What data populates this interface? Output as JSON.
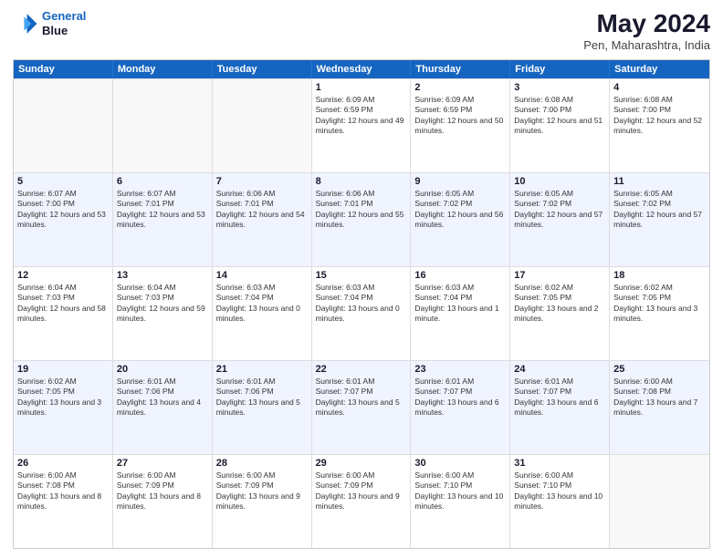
{
  "header": {
    "logo_line1": "General",
    "logo_line2": "Blue",
    "month": "May 2024",
    "location": "Pen, Maharashtra, India"
  },
  "weekdays": [
    "Sunday",
    "Monday",
    "Tuesday",
    "Wednesday",
    "Thursday",
    "Friday",
    "Saturday"
  ],
  "rows": [
    {
      "alt": false,
      "cells": [
        {
          "day": "",
          "empty": true
        },
        {
          "day": "",
          "empty": true
        },
        {
          "day": "",
          "empty": true
        },
        {
          "day": "1",
          "sunrise": "6:09 AM",
          "sunset": "6:59 PM",
          "daylight": "12 hours and 49 minutes."
        },
        {
          "day": "2",
          "sunrise": "6:09 AM",
          "sunset": "6:59 PM",
          "daylight": "12 hours and 50 minutes."
        },
        {
          "day": "3",
          "sunrise": "6:08 AM",
          "sunset": "7:00 PM",
          "daylight": "12 hours and 51 minutes."
        },
        {
          "day": "4",
          "sunrise": "6:08 AM",
          "sunset": "7:00 PM",
          "daylight": "12 hours and 52 minutes."
        }
      ]
    },
    {
      "alt": true,
      "cells": [
        {
          "day": "5",
          "sunrise": "6:07 AM",
          "sunset": "7:00 PM",
          "daylight": "12 hours and 53 minutes."
        },
        {
          "day": "6",
          "sunrise": "6:07 AM",
          "sunset": "7:01 PM",
          "daylight": "12 hours and 53 minutes."
        },
        {
          "day": "7",
          "sunrise": "6:06 AM",
          "sunset": "7:01 PM",
          "daylight": "12 hours and 54 minutes."
        },
        {
          "day": "8",
          "sunrise": "6:06 AM",
          "sunset": "7:01 PM",
          "daylight": "12 hours and 55 minutes."
        },
        {
          "day": "9",
          "sunrise": "6:05 AM",
          "sunset": "7:02 PM",
          "daylight": "12 hours and 56 minutes."
        },
        {
          "day": "10",
          "sunrise": "6:05 AM",
          "sunset": "7:02 PM",
          "daylight": "12 hours and 57 minutes."
        },
        {
          "day": "11",
          "sunrise": "6:05 AM",
          "sunset": "7:02 PM",
          "daylight": "12 hours and 57 minutes."
        }
      ]
    },
    {
      "alt": false,
      "cells": [
        {
          "day": "12",
          "sunrise": "6:04 AM",
          "sunset": "7:03 PM",
          "daylight": "12 hours and 58 minutes."
        },
        {
          "day": "13",
          "sunrise": "6:04 AM",
          "sunset": "7:03 PM",
          "daylight": "12 hours and 59 minutes."
        },
        {
          "day": "14",
          "sunrise": "6:03 AM",
          "sunset": "7:04 PM",
          "daylight": "13 hours and 0 minutes."
        },
        {
          "day": "15",
          "sunrise": "6:03 AM",
          "sunset": "7:04 PM",
          "daylight": "13 hours and 0 minutes."
        },
        {
          "day": "16",
          "sunrise": "6:03 AM",
          "sunset": "7:04 PM",
          "daylight": "13 hours and 1 minute."
        },
        {
          "day": "17",
          "sunrise": "6:02 AM",
          "sunset": "7:05 PM",
          "daylight": "13 hours and 2 minutes."
        },
        {
          "day": "18",
          "sunrise": "6:02 AM",
          "sunset": "7:05 PM",
          "daylight": "13 hours and 3 minutes."
        }
      ]
    },
    {
      "alt": true,
      "cells": [
        {
          "day": "19",
          "sunrise": "6:02 AM",
          "sunset": "7:05 PM",
          "daylight": "13 hours and 3 minutes."
        },
        {
          "day": "20",
          "sunrise": "6:01 AM",
          "sunset": "7:06 PM",
          "daylight": "13 hours and 4 minutes."
        },
        {
          "day": "21",
          "sunrise": "6:01 AM",
          "sunset": "7:06 PM",
          "daylight": "13 hours and 5 minutes."
        },
        {
          "day": "22",
          "sunrise": "6:01 AM",
          "sunset": "7:07 PM",
          "daylight": "13 hours and 5 minutes."
        },
        {
          "day": "23",
          "sunrise": "6:01 AM",
          "sunset": "7:07 PM",
          "daylight": "13 hours and 6 minutes."
        },
        {
          "day": "24",
          "sunrise": "6:01 AM",
          "sunset": "7:07 PM",
          "daylight": "13 hours and 6 minutes."
        },
        {
          "day": "25",
          "sunrise": "6:00 AM",
          "sunset": "7:08 PM",
          "daylight": "13 hours and 7 minutes."
        }
      ]
    },
    {
      "alt": false,
      "cells": [
        {
          "day": "26",
          "sunrise": "6:00 AM",
          "sunset": "7:08 PM",
          "daylight": "13 hours and 8 minutes."
        },
        {
          "day": "27",
          "sunrise": "6:00 AM",
          "sunset": "7:09 PM",
          "daylight": "13 hours and 8 minutes."
        },
        {
          "day": "28",
          "sunrise": "6:00 AM",
          "sunset": "7:09 PM",
          "daylight": "13 hours and 9 minutes."
        },
        {
          "day": "29",
          "sunrise": "6:00 AM",
          "sunset": "7:09 PM",
          "daylight": "13 hours and 9 minutes."
        },
        {
          "day": "30",
          "sunrise": "6:00 AM",
          "sunset": "7:10 PM",
          "daylight": "13 hours and 10 minutes."
        },
        {
          "day": "31",
          "sunrise": "6:00 AM",
          "sunset": "7:10 PM",
          "daylight": "13 hours and 10 minutes."
        },
        {
          "day": "",
          "empty": true
        }
      ]
    }
  ]
}
